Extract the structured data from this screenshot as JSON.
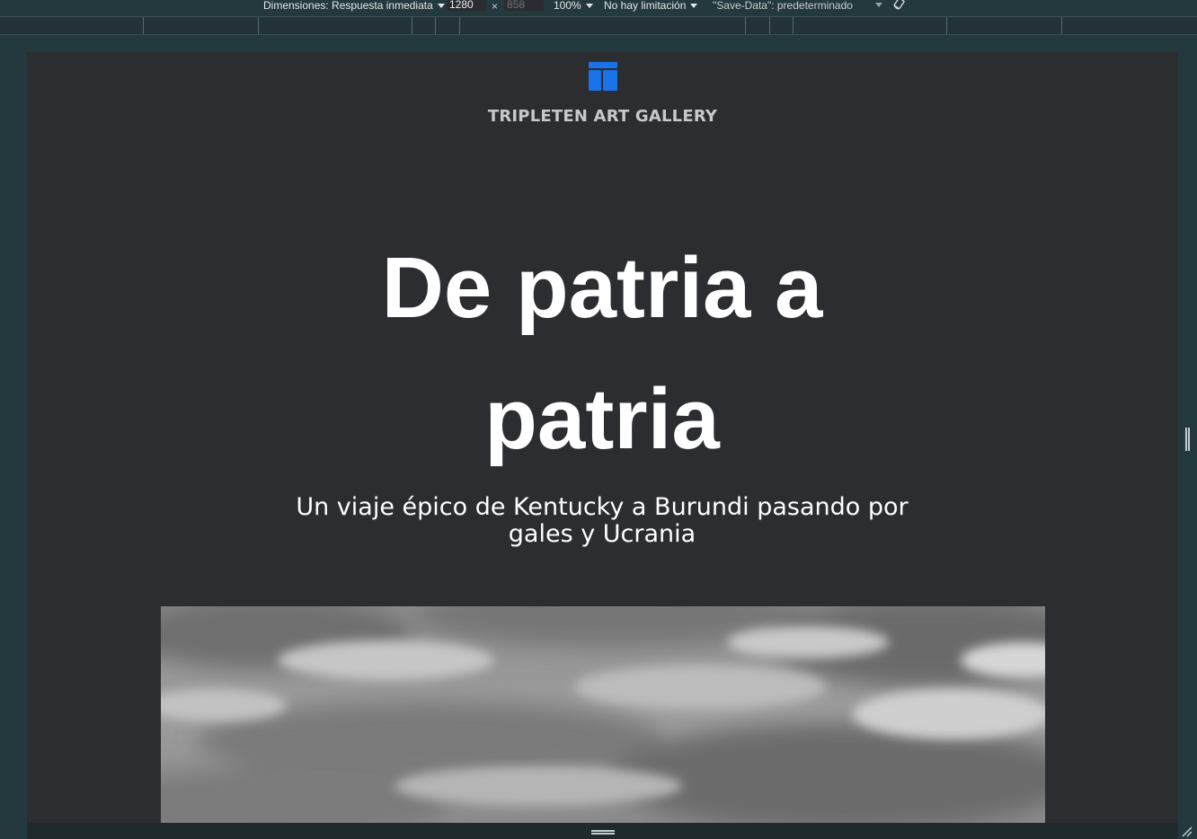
{
  "devtools": {
    "dimensions_label": "Dimensiones: Respuesta inmediata",
    "width_value": "1280",
    "times_symbol": "×",
    "height_value": "858",
    "zoom": "100%",
    "throttling": "No hay limitación",
    "save_data": "\"Save-Data\": predeterminado",
    "rotate_icon": "rotate-icon"
  },
  "page": {
    "logo_icon": "gallery-logo-icon",
    "brand": "TRIPLETEN ART GALLERY",
    "title_line1": "De patria a",
    "title_line2": "patria",
    "subtitle_line1": "Un viaje épico de Kentucky a Burundi pasando por",
    "subtitle_line2": "gales y Ucrania",
    "accent_color": "#1a73e8",
    "background_color": "#2c2d31"
  }
}
